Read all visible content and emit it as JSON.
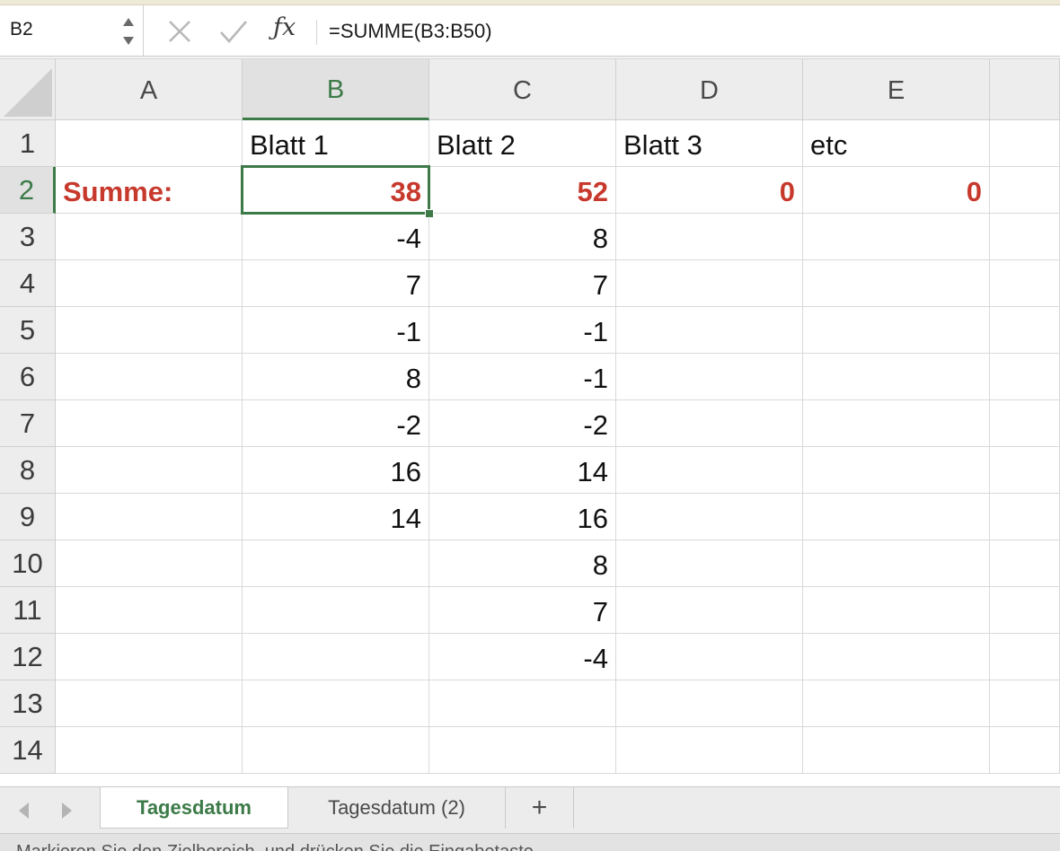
{
  "formula_bar": {
    "name_box": "B2",
    "formula": "=SUMME(B3:B50)"
  },
  "columns": [
    "A",
    "B",
    "C",
    "D",
    "E"
  ],
  "active_column": "B",
  "active_row": "2",
  "rows": [
    {
      "num": "1",
      "cells": {
        "B": "Blatt 1",
        "C": "Blatt 2",
        "D": "Blatt 3",
        "E": "etc"
      }
    },
    {
      "num": "2",
      "cells": {
        "A": "Summe:",
        "B": "38",
        "C": "52",
        "D": "0",
        "E": "0"
      }
    },
    {
      "num": "3",
      "cells": {
        "B": "-4",
        "C": "8"
      }
    },
    {
      "num": "4",
      "cells": {
        "B": "7",
        "C": "7"
      }
    },
    {
      "num": "5",
      "cells": {
        "B": "-1",
        "C": "-1"
      }
    },
    {
      "num": "6",
      "cells": {
        "B": "8",
        "C": "-1"
      }
    },
    {
      "num": "7",
      "cells": {
        "B": "-2",
        "C": "-2"
      }
    },
    {
      "num": "8",
      "cells": {
        "B": "16",
        "C": "14"
      }
    },
    {
      "num": "9",
      "cells": {
        "B": "14",
        "C": "16"
      }
    },
    {
      "num": "10",
      "cells": {
        "C": "8"
      }
    },
    {
      "num": "11",
      "cells": {
        "C": "7"
      }
    },
    {
      "num": "12",
      "cells": {
        "C": "-4"
      }
    },
    {
      "num": "13",
      "cells": {}
    },
    {
      "num": "14",
      "cells": {}
    }
  ],
  "sheet_tabs": [
    {
      "label": "Tagesdatum",
      "active": true
    },
    {
      "label": "Tagesdatum (2)",
      "active": false
    }
  ],
  "status_bar": {
    "message": "Markieren Sie den Zielbereich, und drücken Sie die Eingabetaste."
  },
  "colors": {
    "accent_green": "#3c7a48",
    "sum_red": "#c7392c"
  },
  "icons": {
    "cancel": "x-icon",
    "enter": "checkmark-icon",
    "function": "fx-icon",
    "stepper": "up-down-stepper-icon",
    "add_sheet": "plus-icon",
    "prev": "chevron-left-icon",
    "next": "chevron-right-icon"
  }
}
